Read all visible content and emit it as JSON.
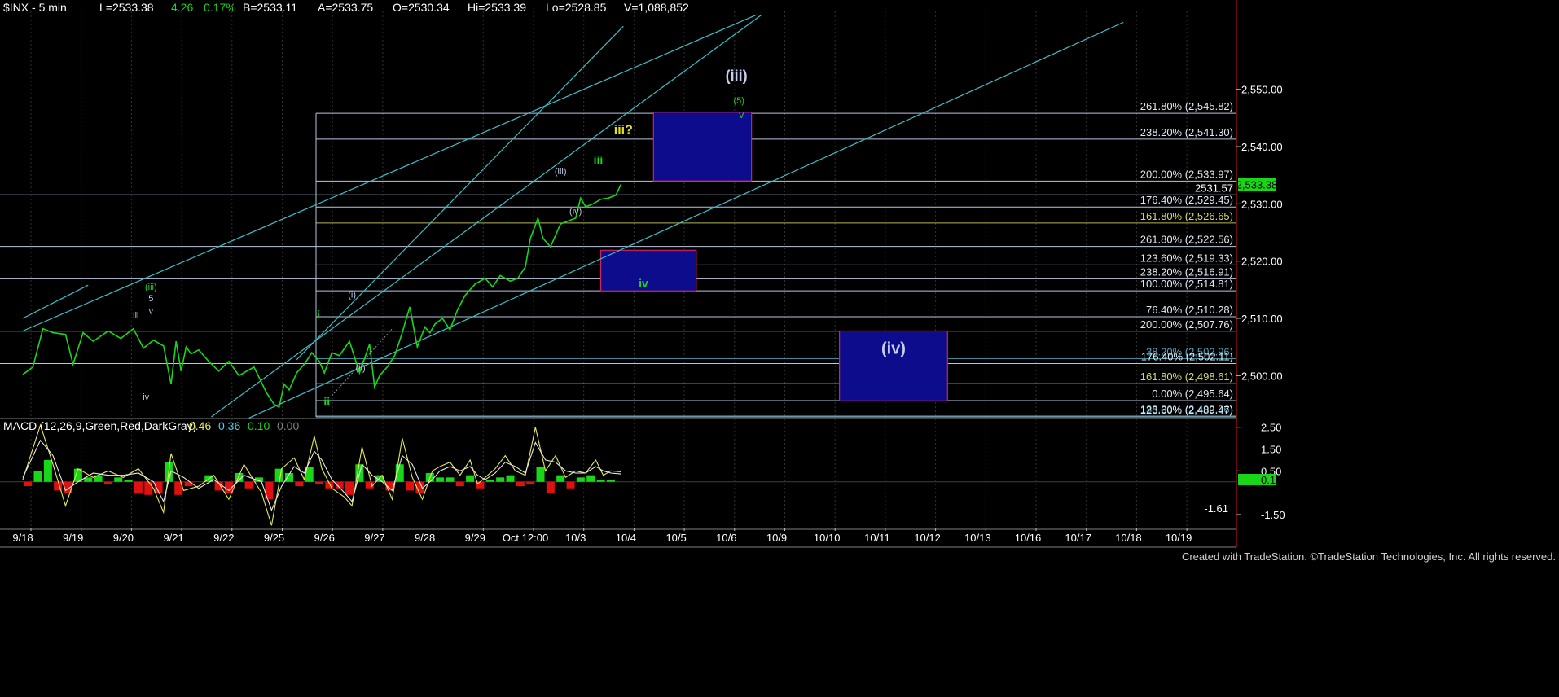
{
  "header": {
    "symbol": "$INX - 5 min",
    "fields": [
      {
        "label": "L=2533.38",
        "color": "#ffffff"
      },
      {
        "label": "4.26",
        "color": "#19d619"
      },
      {
        "label": "0.17%",
        "color": "#19d619"
      },
      {
        "label": "B=2533.11",
        "color": "#ffffff"
      },
      {
        "label": "A=2533.75",
        "color": "#ffffff"
      },
      {
        "label": "O=2530.34",
        "color": "#ffffff"
      },
      {
        "label": "Hi=2533.39",
        "color": "#ffffff"
      },
      {
        "label": "Lo=2528.85",
        "color": "#ffffff"
      },
      {
        "label": "V=1,088,852",
        "color": "#ffffff"
      }
    ]
  },
  "macd_header": {
    "label": "MACD (12,26,9,Green,Red,DarkGray)",
    "values": [
      {
        "text": "0.46",
        "color": "#e8e85a"
      },
      {
        "text": "0.36",
        "color": "#56c8e8"
      },
      {
        "text": "0.10",
        "color": "#19d619"
      },
      {
        "text": "0.00",
        "color": "#808080"
      }
    ]
  },
  "footer": {
    "credit": "Created with TradeStation. ©TradeStation Technologies, Inc. All rights reserved."
  },
  "chart_data": [
    {
      "type": "line",
      "title": "$INX - 5 min",
      "x_labels": [
        "9/18",
        "9/19",
        "9/20",
        "9/21",
        "9/22",
        "9/25",
        "9/26",
        "9/27",
        "9/28",
        "9/29",
        "Oct 12:00",
        "10/3",
        "10/4",
        "10/5",
        "10/6",
        "10/9",
        "10/10",
        "10/11",
        "10/12",
        "10/13",
        "10/16",
        "10/17",
        "10/18",
        "10/19"
      ],
      "y_ticks": [
        2500.0,
        2510.0,
        2520.0,
        2530.0,
        2540.0,
        2550.0
      ],
      "y_tick_labels": [
        "2,500.00",
        "2,510.00",
        "2,520.00",
        "2,530.00",
        "2,540.00",
        "2,550.00"
      ],
      "ylim": [
        2492.8,
        2563.6
      ],
      "last_price_label": "2,533.38",
      "last_price": 2533.38,
      "price_note": "2531.57",
      "series": [
        {
          "color": "#19d619",
          "x": [
            0,
            0.2,
            0.4,
            0.6,
            0.85,
            1.0,
            1.2,
            1.4,
            1.7,
            1.95,
            2.2,
            2.4,
            2.6,
            2.8,
            2.95,
            3.05,
            3.15,
            3.25,
            3.35,
            3.5,
            3.7,
            3.9,
            4.1,
            4.3,
            4.6,
            4.85,
            5.0,
            5.1,
            5.2,
            5.3,
            5.45,
            5.6,
            5.75,
            5.9,
            6.0,
            6.15,
            6.3,
            6.5,
            6.7,
            6.9,
            7.0,
            7.1,
            7.25,
            7.4,
            7.55,
            7.7,
            7.85,
            8.0,
            8.1,
            8.2,
            8.35,
            8.5,
            8.65,
            8.8,
            9.0,
            9.2,
            9.35,
            9.5,
            9.7,
            9.85,
            10.0,
            10.1,
            10.25,
            10.35,
            10.5,
            10.7,
            10.85,
            11.0,
            11.1,
            11.2,
            11.35,
            11.5,
            11.65,
            11.8,
            11.9
          ],
          "y": [
            2500.2,
            2501.5,
            2508.2,
            2507.5,
            2507.2,
            2502.0,
            2507.5,
            2506.0,
            2507.8,
            2506.5,
            2508.2,
            2504.8,
            2506.2,
            2505.2,
            2498.5,
            2506.0,
            2500.8,
            2505.0,
            2503.8,
            2504.5,
            2502.5,
            2500.8,
            2502.5,
            2500.0,
            2501.5,
            2497.0,
            2495.0,
            2494.5,
            2498.5,
            2497.5,
            2500.5,
            2502.0,
            2504.0,
            2502.5,
            2500.5,
            2504.0,
            2503.5,
            2506.0,
            2500.5,
            2505.5,
            2498.0,
            2500.0,
            2501.5,
            2503.5,
            2507.5,
            2512.0,
            2505.0,
            2508.5,
            2507.5,
            2509.0,
            2510.0,
            2508.0,
            2511.5,
            2514.0,
            2516.0,
            2517.0,
            2515.5,
            2517.5,
            2516.5,
            2517.0,
            2519.0,
            2524.0,
            2527.5,
            2524.0,
            2522.5,
            2526.5,
            2527.0,
            2527.5,
            2531.0,
            2529.5,
            2530.0,
            2530.8,
            2531.0,
            2531.5,
            2533.38
          ]
        }
      ],
      "fib_levels": [
        {
          "label": "261.80% (2,545.82)",
          "value": 2545.82,
          "color": "#b9c6e0",
          "text_color": "#e0e8f0"
        },
        {
          "label": "238.20% (2,541.30)",
          "value": 2541.3,
          "color": "#b9c6e0",
          "text_color": "#e0e8f0"
        },
        {
          "label": "200.00% (2,533.97)",
          "value": 2533.97,
          "color": "#b9c6e0",
          "text_color": "#e0e8f0"
        },
        {
          "label": "176.40% (2,529.45)",
          "value": 2529.45,
          "color": "#b9c6e0",
          "text_color": "#e0e8f0"
        },
        {
          "label": "161.80% (2,526.65)",
          "value": 2526.65,
          "color": "#b5b55a",
          "text_color": "#d8d870"
        },
        {
          "label": "261.80% (2,522.56)",
          "value": 2522.56,
          "color": "#b9c6e0",
          "text_color": "#e0e8f0"
        },
        {
          "label": "123.60% (2,519.33)",
          "value": 2519.33,
          "color": "#b9c6e0",
          "text_color": "#e0e8f0"
        },
        {
          "label": "238.20% (2,516.91)",
          "value": 2516.91,
          "color": "#b9c6e0",
          "text_color": "#e0e8f0"
        },
        {
          "label": "100.00% (2,514.81)",
          "value": 2514.81,
          "color": "#b9c6e0",
          "text_color": "#e0e8f0"
        },
        {
          "label": "76.40% (2,510.28)",
          "value": 2510.28,
          "color": "#b9c6e0",
          "text_color": "#e0e8f0"
        },
        {
          "label": "200.00% (2,507.76)",
          "value": 2507.76,
          "color": "#b5b55a",
          "text_color": "#e0e8f0"
        },
        {
          "label": "38.20% (2,502.96)",
          "value": 2502.96,
          "color": "#3c8aa0",
          "text_color": "#56a0b8"
        },
        {
          "label": "176.40% (2,502.11)",
          "value": 2502.11,
          "color": "#b9c6e0",
          "text_color": "#e0e8f0"
        },
        {
          "label": "161.80% (2,498.61)",
          "value": 2498.61,
          "color": "#b5b55a",
          "text_color": "#d8d870"
        },
        {
          "label": "0.00% (2,495.64)",
          "value": 2495.64,
          "color": "#b9c6e0",
          "text_color": "#e0e8f0"
        },
        {
          "label": "138.20% (2,492.96)",
          "value": 2492.96,
          "color": "#3c8aa0",
          "text_color": "#56a0b8"
        },
        {
          "label": "123.60% (2,489.47)",
          "value": 2489.47,
          "color": "#b9c6e0",
          "text_color": "#e0e8f0"
        }
      ],
      "target_boxes": [
        {
          "name": "box-iii",
          "x_from": 12.55,
          "x_to": 14.5,
          "y_from": 2534.0,
          "y_to": 2546.0,
          "label": ""
        },
        {
          "name": "box-iv-small",
          "x_from": 11.5,
          "x_to": 13.4,
          "y_from": 2514.8,
          "y_to": 2521.9,
          "label": ""
        },
        {
          "name": "box-iv-large",
          "x_from": 16.25,
          "x_to": 18.4,
          "y_from": 2495.6,
          "y_to": 2507.8,
          "label": "(iv)"
        }
      ],
      "wave_labels": [
        {
          "text": "(iii)",
          "x": 14.2,
          "y": 2551.5,
          "color": "#c8d0f0",
          "size": 18
        },
        {
          "text": "(5)",
          "x": 14.25,
          "y": 2547.5,
          "color": "#19d619",
          "size": 11
        },
        {
          "text": "v",
          "x": 14.3,
          "y": 2545.0,
          "color": "#19d619",
          "size": 12
        },
        {
          "text": "iii?",
          "x": 11.95,
          "y": 2542.2,
          "color": "#e0e020",
          "size": 16
        },
        {
          "text": "iii",
          "x": 11.45,
          "y": 2537.0,
          "color": "#19d619",
          "size": 14
        },
        {
          "text": "(iii)",
          "x": 10.7,
          "y": 2535.2,
          "color": "#b9c6e0",
          "size": 11
        },
        {
          "text": "(iv)",
          "x": 11.0,
          "y": 2528.2,
          "color": "#b9c6e0",
          "size": 11
        },
        {
          "text": "iv",
          "x": 12.35,
          "y": 2515.5,
          "color": "#19d619",
          "size": 14
        },
        {
          "text": "(iii)",
          "x": 2.55,
          "y": 2515.0,
          "color": "#19d619",
          "size": 11
        },
        {
          "text": "5",
          "x": 2.55,
          "y": 2513.0,
          "color": "#c8d0f0",
          "size": 11
        },
        {
          "text": "v",
          "x": 2.55,
          "y": 2510.8,
          "color": "#b9c6e0",
          "size": 11
        },
        {
          "text": "iii",
          "x": 2.25,
          "y": 2510.0,
          "color": "#b9c6e0",
          "size": 11
        },
        {
          "text": "iv",
          "x": 2.45,
          "y": 2495.8,
          "color": "#b9c6e0",
          "size": 11
        },
        {
          "text": "i",
          "x": 5.88,
          "y": 2510.0,
          "color": "#19d619",
          "size": 14
        },
        {
          "text": "ii",
          "x": 6.05,
          "y": 2494.8,
          "color": "#19d619",
          "size": 14
        },
        {
          "text": "(i)",
          "x": 6.55,
          "y": 2513.6,
          "color": "#b9c6e0",
          "size": 11
        },
        {
          "text": "(ii)",
          "x": 6.72,
          "y": 2500.8,
          "color": "#b9c6e0",
          "size": 11
        }
      ],
      "trend_lines": [
        {
          "x1": 0,
          "y1": 2510.0,
          "x2": 1.3,
          "y2": 2515.8,
          "color": "#3cc0c8"
        },
        {
          "x1": 3.75,
          "y1": 2492.8,
          "x2": 14.7,
          "y2": 2563.0,
          "color": "#3cc0c8"
        },
        {
          "x1": 5.45,
          "y1": 2502.8,
          "x2": 11.95,
          "y2": 2561.0,
          "color": "#3cc0c8"
        },
        {
          "x1": 0,
          "y1": 2507.8,
          "x2": 14.6,
          "y2": 2563.0,
          "color": "#3cc0c8"
        },
        {
          "x1": 4.5,
          "y1": 2492.6,
          "x2": 21.9,
          "y2": 2561.7,
          "color": "#3cc0c8"
        }
      ]
    },
    {
      "type": "line",
      "title": "MACD (12,26,9,Green,Red,DarkGray)",
      "y_tick_labels": [
        "2.50",
        "1.50",
        "0.50",
        "-1.50"
      ],
      "y_ticks": [
        2.5,
        1.5,
        0.5,
        -1.5
      ],
      "ylim": [
        -2.1,
        2.9
      ],
      "last_value_label": "0.10",
      "min_label": "-1.61",
      "series": [
        {
          "name": "MACD",
          "color": "#e8e85a",
          "x": [
            0,
            0.35,
            0.6,
            0.85,
            1.1,
            1.4,
            1.7,
            2.0,
            2.3,
            2.6,
            2.8,
            2.95,
            3.2,
            3.5,
            3.8,
            4.1,
            4.4,
            4.75,
            4.95,
            5.15,
            5.4,
            5.6,
            5.8,
            5.95,
            6.15,
            6.4,
            6.55,
            6.75,
            6.95,
            7.15,
            7.35,
            7.55,
            7.75,
            7.95,
            8.15,
            8.3,
            8.5,
            8.7,
            8.9,
            9.05,
            9.2,
            9.4,
            9.6,
            9.8,
            10.0,
            10.2,
            10.4,
            10.6,
            10.8,
            11.0,
            11.2,
            11.4,
            11.55,
            11.7,
            11.9
          ],
          "y": [
            0.1,
            2.6,
            0.8,
            -1.1,
            0.6,
            0.2,
            0.5,
            0.2,
            0.6,
            -0.3,
            -1.4,
            1.3,
            -0.4,
            -0.2,
            0.3,
            -0.8,
            0.8,
            -0.5,
            -2.0,
            0.6,
            1.1,
            0.1,
            2.1,
            0.6,
            -0.3,
            -0.7,
            -1.1,
            1.6,
            -0.2,
            0.3,
            -0.8,
            2.0,
            0.2,
            -0.8,
            0.5,
            0.7,
            0.9,
            0.3,
            1.0,
            -0.1,
            0.2,
            0.6,
            1.2,
            0.5,
            0.3,
            2.5,
            0.5,
            1.2,
            0.2,
            0.5,
            0.4,
            1.0,
            0.3,
            0.5,
            0.46
          ]
        },
        {
          "name": "Signal",
          "color": "#e8e8e8",
          "x": [
            0,
            0.35,
            0.6,
            0.85,
            1.1,
            1.4,
            1.7,
            2.0,
            2.3,
            2.6,
            2.8,
            2.95,
            3.2,
            3.5,
            3.8,
            4.1,
            4.4,
            4.75,
            4.95,
            5.15,
            5.4,
            5.6,
            5.8,
            5.95,
            6.15,
            6.4,
            6.55,
            6.75,
            6.95,
            7.15,
            7.35,
            7.55,
            7.75,
            7.95,
            8.15,
            8.3,
            8.5,
            8.7,
            8.9,
            9.05,
            9.2,
            9.4,
            9.6,
            9.8,
            10.0,
            10.2,
            10.4,
            10.6,
            10.8,
            11.0,
            11.2,
            11.4,
            11.55,
            11.7,
            11.9
          ],
          "y": [
            0.2,
            1.9,
            1.2,
            -0.4,
            0.0,
            0.4,
            0.3,
            0.3,
            0.4,
            0.0,
            -0.9,
            0.5,
            0.2,
            -0.3,
            0.1,
            -0.4,
            0.3,
            0.0,
            -1.3,
            -0.2,
            0.7,
            0.4,
            1.4,
            1.0,
            0.1,
            -0.5,
            -0.9,
            0.8,
            0.3,
            0.0,
            -0.4,
            1.2,
            0.8,
            -0.3,
            0.1,
            0.5,
            0.7,
            0.5,
            0.7,
            0.3,
            0.1,
            0.4,
            0.9,
            0.7,
            0.4,
            1.8,
            1.0,
            0.9,
            0.5,
            0.4,
            0.4,
            0.7,
            0.5,
            0.4,
            0.36
          ]
        }
      ],
      "histogram": {
        "x": [
          0.1,
          0.3,
          0.5,
          0.7,
          0.9,
          1.1,
          1.3,
          1.5,
          1.7,
          1.9,
          2.1,
          2.3,
          2.5,
          2.7,
          2.9,
          3.1,
          3.3,
          3.5,
          3.7,
          3.9,
          4.1,
          4.3,
          4.5,
          4.7,
          4.9,
          5.1,
          5.3,
          5.5,
          5.7,
          5.9,
          6.1,
          6.3,
          6.5,
          6.7,
          6.9,
          7.1,
          7.3,
          7.5,
          7.7,
          7.9,
          8.1,
          8.3,
          8.5,
          8.7,
          8.9,
          9.1,
          9.3,
          9.5,
          9.7,
          9.9,
          10.1,
          10.3,
          10.5,
          10.7,
          10.9,
          11.1,
          11.3,
          11.5,
          11.7
        ],
        "y": [
          -0.2,
          0.5,
          1.0,
          -0.4,
          -0.5,
          0.6,
          0.2,
          0.3,
          -0.1,
          0.2,
          0.1,
          -0.5,
          -0.6,
          -0.5,
          0.9,
          -0.6,
          -0.2,
          0.0,
          0.3,
          -0.4,
          -0.5,
          0.4,
          -0.3,
          0.2,
          -0.8,
          0.6,
          0.4,
          -0.2,
          0.7,
          -0.1,
          -0.3,
          -0.3,
          -0.6,
          0.8,
          -0.3,
          0.3,
          -0.4,
          0.8,
          -0.4,
          -0.5,
          0.4,
          0.2,
          0.2,
          -0.2,
          0.3,
          -0.3,
          0.1,
          0.2,
          0.3,
          -0.2,
          -0.1,
          0.7,
          -0.5,
          0.3,
          -0.3,
          0.2,
          0.3,
          0.1,
          0.1
        ],
        "pos_color": "#19d619",
        "neg_color": "#e01010"
      }
    }
  ]
}
